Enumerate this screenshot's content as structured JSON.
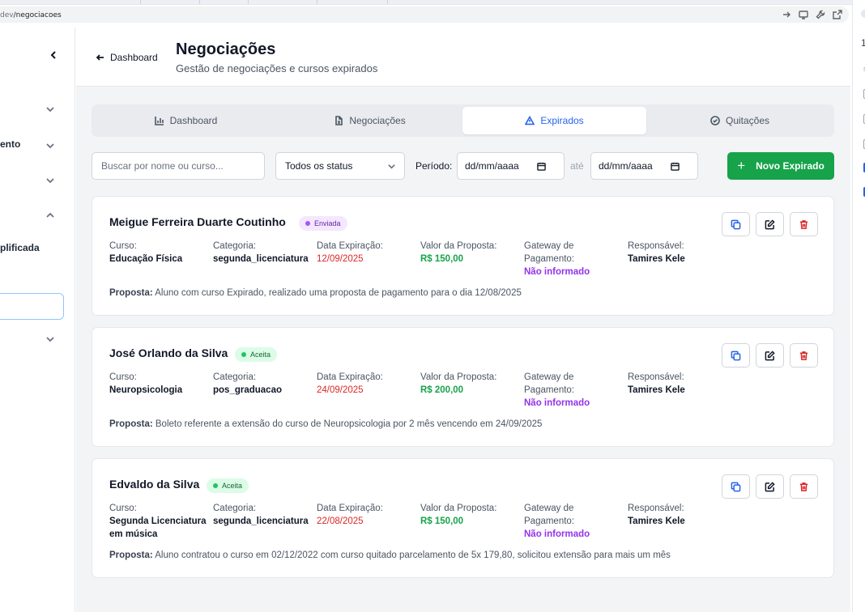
{
  "browser": {
    "url_host": "dev",
    "url_path": "/negociacoes"
  },
  "right_panel": {
    "number": "1",
    "dot": "s"
  },
  "sidebar": {
    "items": [
      {
        "label": "ento"
      },
      {
        "label": "plificada"
      }
    ]
  },
  "header": {
    "back_label": "Dashboard",
    "title": "Negociações",
    "subtitle": "Gestão de negociações e cursos expirados"
  },
  "tabs": [
    {
      "label": "Dashboard",
      "icon": "bar-chart-icon",
      "active": false
    },
    {
      "label": "Negociações",
      "icon": "document-icon",
      "active": false
    },
    {
      "label": "Expirados",
      "icon": "warning-icon",
      "active": true
    },
    {
      "label": "Quitações",
      "icon": "check-circle-icon",
      "active": false
    }
  ],
  "filters": {
    "search_placeholder": "Buscar por nome ou curso...",
    "status_value": "Todos os status",
    "period_label": "Período:",
    "date_from": "dd/mm/aaaa",
    "until_label": "até",
    "date_to": "dd/mm/aaaa",
    "new_button": "Novo Expirado"
  },
  "field_labels": {
    "curso": "Curso:",
    "categoria": "Categoria:",
    "data_expiracao": "Data Expiração:",
    "valor": "Valor da Proposta:",
    "gateway": "Gateway de Pagamento:",
    "responsavel": "Responsável:",
    "proposta": "Proposta:"
  },
  "records": [
    {
      "name": "Meigue Ferreira Duarte Coutinho",
      "status": "Enviada",
      "status_color": "#a855f7",
      "curso": "Educação Física",
      "categoria": "segunda_licenciatura",
      "data_expiracao": "12/09/2025",
      "valor": "R$ 150,00",
      "gateway": "Não informado",
      "responsavel": "Tamires Kele",
      "proposta": "Aluno com curso Expirado, realizado uma proposta de pagamento para o dia 12/08/2025"
    },
    {
      "name": "José Orlando da Silva",
      "status": "Aceita",
      "status_color": "#22c55e",
      "curso": "Neuropsicologia",
      "categoria": "pos_graduacao",
      "data_expiracao": "24/09/2025",
      "valor": "R$ 200,00",
      "gateway": "Não informado",
      "responsavel": "Tamires Kele",
      "proposta": "Boleto referente a extensão do curso de Neuropsicologia por 2 mês vencendo em 24/09/2025"
    },
    {
      "name": "Edvaldo da Silva",
      "status": "Aceita",
      "status_color": "#22c55e",
      "curso": "Segunda Licenciatura em música",
      "categoria": "segunda_licenciatura",
      "data_expiracao": "22/08/2025",
      "valor": "R$ 150,00",
      "gateway": "Não informado",
      "responsavel": "Tamires Kele",
      "proposta": "Aluno contratou o curso em 02/12/2022 com curso quitado parcelamento de 5x 179,80, solicitou extensão para mais um mês"
    }
  ],
  "colors": {
    "accent": "#2563eb",
    "primary_button": "#16a34a",
    "expiry_date": "#dc2626",
    "value": "#16a34a",
    "gateway": "#9333ea"
  }
}
